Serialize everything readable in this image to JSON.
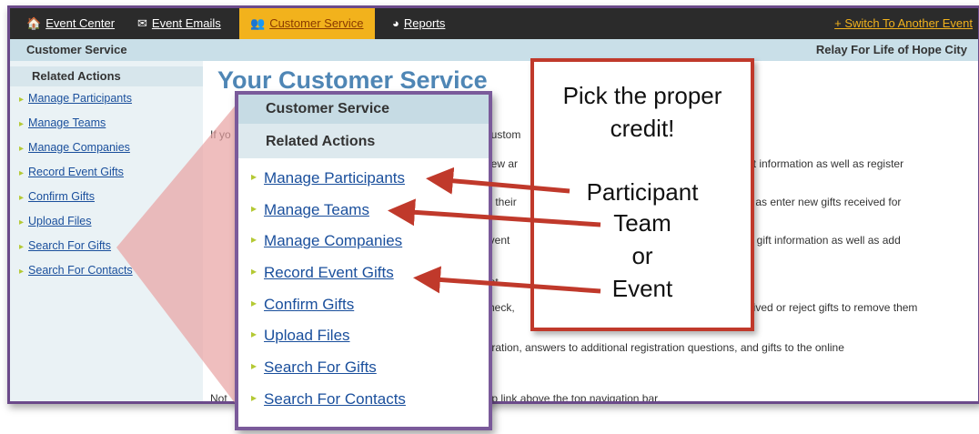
{
  "nav": {
    "items": [
      {
        "label": "Event Center",
        "icon": "home-icon"
      },
      {
        "label": "Event Emails",
        "icon": "envelope-icon"
      },
      {
        "label": "Customer Service",
        "icon": "people-icon"
      },
      {
        "label": "Reports",
        "icon": "chart-icon"
      }
    ],
    "switch": "+ Switch To Another Event"
  },
  "crumb": {
    "left": "Customer Service",
    "right": "Relay For Life of Hope City"
  },
  "sidebar": {
    "heading": "Related Actions",
    "items": [
      "Manage Participants",
      "Manage Teams",
      "Manage Companies",
      "Record Event Gifts",
      "Confirm Gifts",
      "Upload Files",
      "Search For Gifts",
      "Search For Contacts"
    ]
  },
  "main": {
    "title": "Your Customer Service",
    "lines": [
      "If yo",
      "Custom",
      "view ar",
      "gift information as well as register",
      "te their",
      "ell as enter new gifts received for",
      "event",
      "nd gift information as well as add",
      "ent",
      "check,",
      "ceived or reject gifts to remove them",
      "stration, answers to additional registration questions, and gifts to the online",
      "Not",
      "elp link above the top navigation bar."
    ]
  },
  "popup": {
    "heading1": "Customer Service",
    "heading2": "Related Actions",
    "items": [
      "Manage Participants",
      "Manage Teams",
      "Manage Companies",
      "Record Event Gifts",
      "Confirm Gifts",
      "Upload Files",
      "Search For Gifts",
      "Search For Contacts"
    ]
  },
  "callout": {
    "line1": "Pick the proper",
    "line2": "credit!",
    "line3": "Participant",
    "line4": "Team",
    "line5": "or",
    "line6": "Event"
  },
  "colors": {
    "accent_tab": "#f2b21c",
    "link": "#1a4f9c",
    "callout_border": "#c0392b",
    "arrow": "#c0392b",
    "popup_border": "#7a5a9a"
  }
}
